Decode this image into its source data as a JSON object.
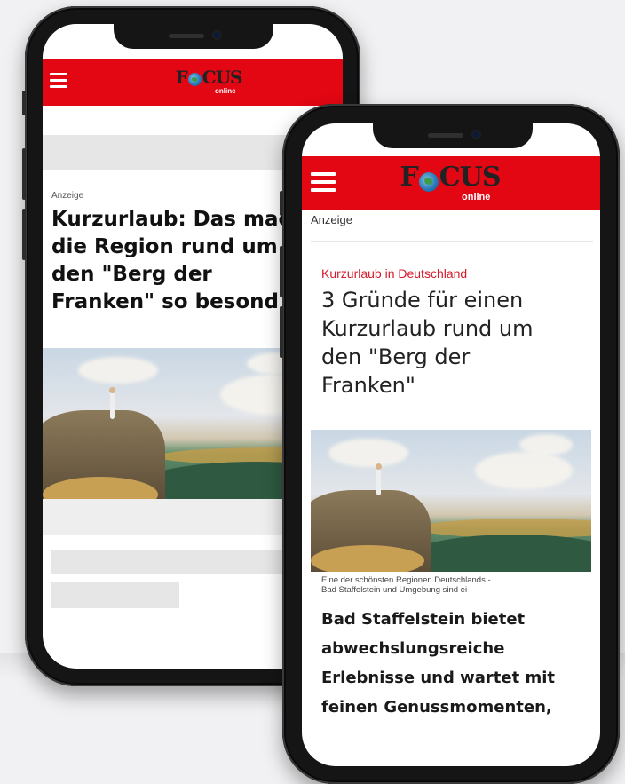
{
  "back_phone": {
    "logo": "FOCUS",
    "logo_sub": "online",
    "ad_label": "Anzeige",
    "headline_lines": [
      "Kurzurlaub: Das mac",
      "die Region rund um",
      "den \"Berg der",
      "Franken\" so besond"
    ]
  },
  "front_phone": {
    "logo": "FOCUS",
    "logo_sub": "online",
    "ad_label": "Anzeige",
    "kicker": "Kurzurlaub in Deutschland",
    "headline_lines": [
      "3 Gründe für einen",
      "Kurzurlaub rund um",
      "den \"Berg der",
      "Franken\""
    ],
    "caption_lines": [
      "Eine der schönsten Regionen Deutschlands -",
      "Bad Staffelstein und Umgebung sind ei"
    ],
    "body_lines": [
      "Bad Staffelstein bietet",
      "abwechslungsreiche",
      "Erlebnisse und wartet mit",
      "feinen Genussmomenten,"
    ]
  },
  "colors": {
    "brand_red": "#e30613",
    "kicker_red": "#d51a2b"
  },
  "icons": [
    "hamburger-menu-icon",
    "globe-logo-icon"
  ]
}
